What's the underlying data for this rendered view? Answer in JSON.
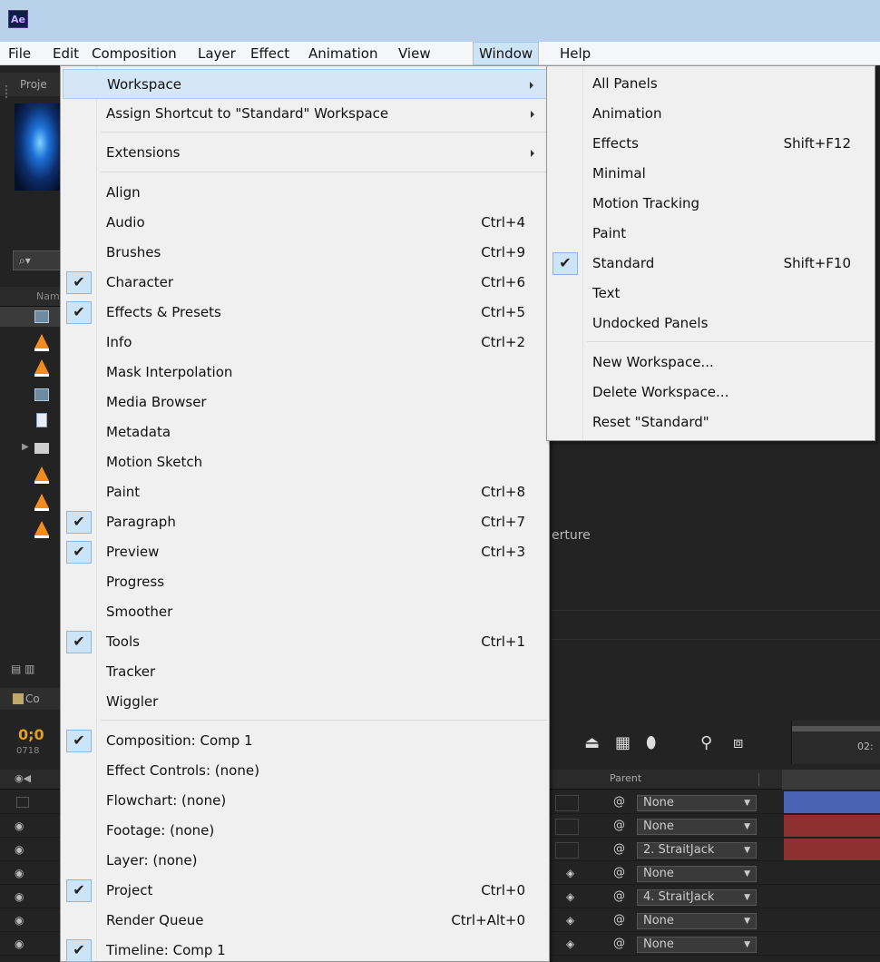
{
  "app": {
    "logo": "Ae",
    "menubar": [
      "File",
      "Edit",
      "Composition",
      "Layer",
      "Effect",
      "Animation",
      "View",
      "Window",
      "Help"
    ],
    "active_menu": "Window"
  },
  "background": {
    "project_tab": "Proje",
    "project_search": "⌕▾",
    "project_col": "Nam",
    "timeline_tab": "Co",
    "timecode": "0;0",
    "timecode_frames": "0718",
    "ruler_label": "02:",
    "parent_header": "Parent",
    "fragment_text": "erture",
    "parent_values": [
      "None",
      "None",
      "2. StraitJack",
      "None",
      "4. StraitJack",
      "None",
      "None"
    ]
  },
  "window_menu": {
    "items": [
      {
        "label": "Workspace",
        "submenu": true,
        "highlight": true
      },
      {
        "label": "Assign Shortcut to \"Standard\" Workspace",
        "submenu": true
      },
      {
        "label": "Extensions",
        "submenu": true
      },
      {
        "label": "Align"
      },
      {
        "label": "Audio",
        "shortcut": "Ctrl+4"
      },
      {
        "label": "Brushes",
        "shortcut": "Ctrl+9"
      },
      {
        "label": "Character",
        "shortcut": "Ctrl+6",
        "checked": true
      },
      {
        "label": "Effects & Presets",
        "shortcut": "Ctrl+5",
        "checked": true
      },
      {
        "label": "Info",
        "shortcut": "Ctrl+2"
      },
      {
        "label": "Mask Interpolation"
      },
      {
        "label": "Media Browser"
      },
      {
        "label": "Metadata"
      },
      {
        "label": "Motion Sketch"
      },
      {
        "label": "Paint",
        "shortcut": "Ctrl+8"
      },
      {
        "label": "Paragraph",
        "shortcut": "Ctrl+7",
        "checked": true
      },
      {
        "label": "Preview",
        "shortcut": "Ctrl+3",
        "checked": true
      },
      {
        "label": "Progress"
      },
      {
        "label": "Smoother"
      },
      {
        "label": "Tools",
        "shortcut": "Ctrl+1",
        "checked": true
      },
      {
        "label": "Tracker"
      },
      {
        "label": "Wiggler"
      },
      {
        "label": "Composition: Comp 1",
        "checked": true
      },
      {
        "label": "Effect Controls: (none)"
      },
      {
        "label": "Flowchart: (none)"
      },
      {
        "label": "Footage: (none)"
      },
      {
        "label": "Layer: (none)"
      },
      {
        "label": "Project",
        "shortcut": "Ctrl+0",
        "checked": true
      },
      {
        "label": "Render Queue",
        "shortcut": "Ctrl+Alt+0"
      },
      {
        "label": "Timeline: Comp 1",
        "checked": true
      }
    ]
  },
  "workspace_menu": {
    "items": [
      {
        "label": "All Panels"
      },
      {
        "label": "Animation"
      },
      {
        "label": "Effects",
        "shortcut": "Shift+F12"
      },
      {
        "label": "Minimal"
      },
      {
        "label": "Motion Tracking"
      },
      {
        "label": "Paint"
      },
      {
        "label": "Standard",
        "shortcut": "Shift+F10",
        "checked": true
      },
      {
        "label": "Text"
      },
      {
        "label": "Undocked Panels"
      },
      {
        "label": "New Workspace..."
      },
      {
        "label": "Delete Workspace..."
      },
      {
        "label": "Reset \"Standard\""
      }
    ]
  },
  "colors": {
    "title_bar": "#b9d1ea",
    "menu_bg": "#f0f0f0",
    "highlight": "#d5e6f7",
    "check_bg": "#cde4f7",
    "timecode": "#e3a01b"
  }
}
